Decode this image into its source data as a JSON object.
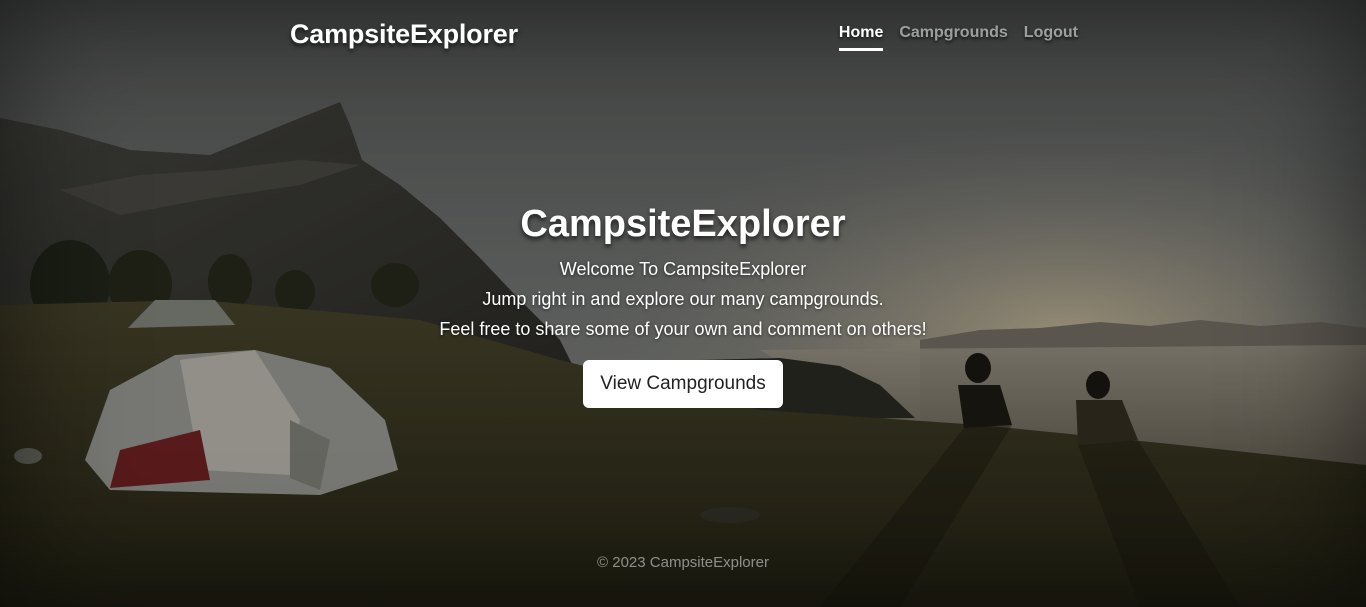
{
  "header": {
    "brand": "CampsiteExplorer",
    "nav": [
      {
        "label": "Home",
        "active": true
      },
      {
        "label": "Campgrounds",
        "active": false
      },
      {
        "label": "Logout",
        "active": false
      }
    ]
  },
  "hero": {
    "title": "CampsiteExplorer",
    "lines": [
      "Welcome To CampsiteExplorer",
      "Jump right in and explore our many campgrounds.",
      "Feel free to share some of your own and comment on others!"
    ],
    "button_label": "View Campgrounds"
  },
  "footer": {
    "text": "© 2023 CampsiteExplorer"
  },
  "colors": {
    "text": "#ffffff",
    "button_bg": "#ffffff",
    "button_text": "#222222"
  }
}
